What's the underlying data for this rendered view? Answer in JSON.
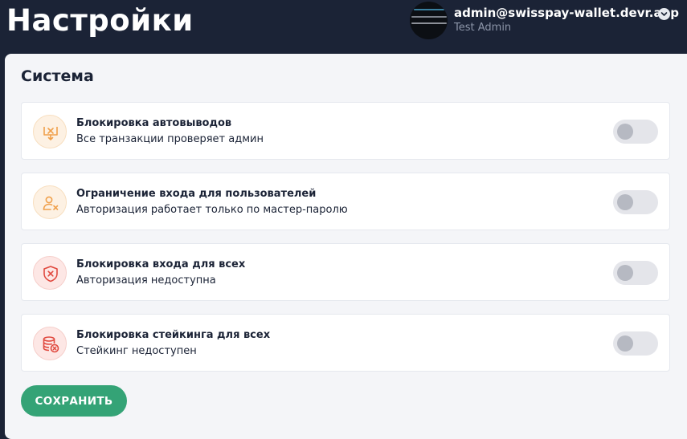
{
  "header": {
    "title": "Настройки",
    "user": {
      "email": "admin@swisspay-wallet.devr.app",
      "role": "Test Admin"
    }
  },
  "section": {
    "title": "Система",
    "settings": [
      {
        "title": "Блокировка автовыводов",
        "description": "Все транзакции проверяет админ",
        "icon": "withdraw-block-icon",
        "enabled": false
      },
      {
        "title": "Ограничение входа для пользователей",
        "description": "Авторизация работает только по мастер-паролю",
        "icon": "user-restrict-icon",
        "enabled": false
      },
      {
        "title": "Блокировка входа для всех",
        "description": "Авторизация недоступна",
        "icon": "shield-block-icon",
        "enabled": false
      },
      {
        "title": "Блокировка стейкинга для всех",
        "description": "Стейкинг недоступен",
        "icon": "staking-block-icon",
        "enabled": false
      }
    ]
  },
  "actions": {
    "save_label": "СОХРАНИТЬ"
  },
  "colors": {
    "header_bg": "#1b2336",
    "panel_bg": "#f4f5f8",
    "accent_orange": "#f0a04b",
    "accent_red": "#e0483e",
    "save_button": "#34a376",
    "toggle_off": "#e4e5ea"
  }
}
